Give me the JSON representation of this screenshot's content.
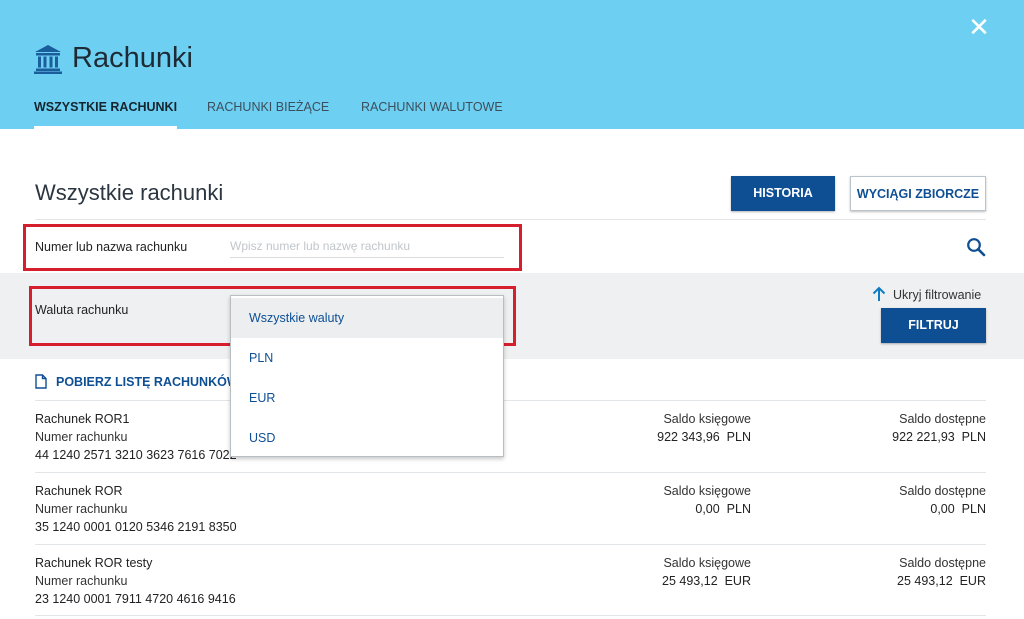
{
  "header": {
    "title": "Rachunki",
    "close_glyph": "✕",
    "tabs": [
      {
        "label": "WSZYSTKIE RACHUNKI",
        "active": true
      },
      {
        "label": "RACHUNKI BIEŻĄCE",
        "active": false
      },
      {
        "label": "RACHUNKI WALUTOWE",
        "active": false
      }
    ]
  },
  "section": {
    "title": "Wszystkie rachunki",
    "history_button": "HISTORIA",
    "statements_button": "WYCIĄGI ZBIORCZE"
  },
  "search": {
    "label": "Numer lub nazwa rachunku",
    "placeholder": "Wpisz numer lub nazwę rachunku",
    "value": ""
  },
  "filter": {
    "currency_label": "Waluta rachunku",
    "hide_filter": "Ukryj filtrowanie",
    "filter_button": "FILTRUJ",
    "currency_options": [
      "Wszystkie waluty",
      "PLN",
      "EUR",
      "USD"
    ],
    "selected_index": 0
  },
  "download_link": "POBIERZ LISTĘ RACHUNKÓW",
  "accounts": [
    {
      "name": "Rachunek ROR1",
      "number_label": "Numer rachunku",
      "number": "44 1240 2571 3210 3623 7616 7022",
      "book_balance_label": "Saldo księgowe",
      "book_balance": "922 343,96",
      "book_currency": "PLN",
      "available_label": "Saldo dostępne",
      "available_balance": "922 221,93",
      "available_currency": "PLN"
    },
    {
      "name": "Rachunek ROR",
      "number_label": "Numer rachunku",
      "number": "35 1240 0001 0120 5346 2191 8350",
      "book_balance_label": "Saldo księgowe",
      "book_balance": "0,00",
      "book_currency": "PLN",
      "available_label": "Saldo dostępne",
      "available_balance": "0,00",
      "available_currency": "PLN"
    },
    {
      "name": "Rachunek ROR testy",
      "number_label": "Numer rachunku",
      "number": "23 1240 0001 7911 4720 4616 9416",
      "book_balance_label": "Saldo księgowe",
      "book_balance": "25 493,12",
      "book_currency": "EUR",
      "available_label": "Saldo dostępne",
      "available_balance": "25 493,12",
      "available_currency": "EUR"
    }
  ],
  "colors": {
    "header_bg": "#6dd0f2",
    "primary": "#0e4f94",
    "highlight_red": "#d61f2c",
    "filter_bg": "#eff0f1"
  },
  "icons": {
    "title": "bank-icon",
    "close": "close-icon",
    "search": "search-icon",
    "hide_filter": "arrow-up-icon",
    "download": "document-icon"
  }
}
